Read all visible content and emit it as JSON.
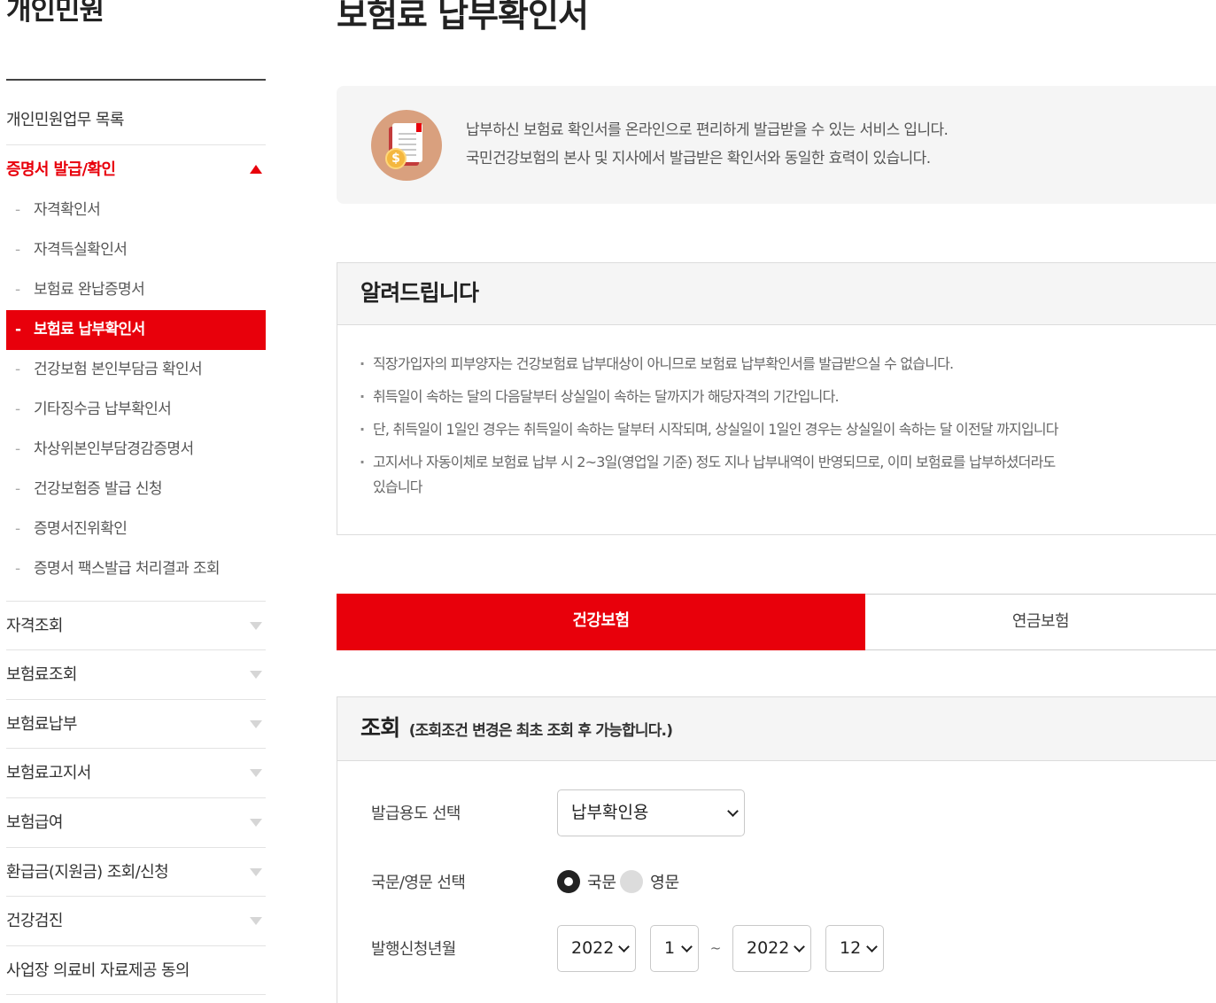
{
  "sidebar": {
    "title": "개인민원",
    "items": [
      {
        "label": "개인민원업무 목록"
      },
      {
        "label": "증명서 발급/확인",
        "open": true
      }
    ],
    "submenu": [
      {
        "label": "자격확인서"
      },
      {
        "label": "자격득실확인서"
      },
      {
        "label": "보험료 완납증명서"
      },
      {
        "label": "보험료 납부확인서",
        "active": true
      },
      {
        "label": "건강보험 본인부담금 확인서"
      },
      {
        "label": "기타징수금 납부확인서"
      },
      {
        "label": "차상위본인부담경감증명서"
      },
      {
        "label": "건강보험증 발급 신청"
      },
      {
        "label": "증명서진위확인"
      },
      {
        "label": "증명서 팩스발급 처리결과 조회"
      }
    ],
    "more_items": [
      {
        "label": "자격조회"
      },
      {
        "label": "보험료조회"
      },
      {
        "label": "보험료납부"
      },
      {
        "label": "보험료고지서"
      },
      {
        "label": "보험급여"
      },
      {
        "label": "환급금(지원금) 조회/신청"
      },
      {
        "label": "건강검진"
      },
      {
        "label": "사업장 의료비 자료제공 동의"
      }
    ],
    "dash": "-"
  },
  "page": {
    "title": "보험료 납부확인서"
  },
  "intro": {
    "line1": "납부하신 보험료 확인서를 온라인으로 편리하게 발급받을 수 있는 서비스 입니다.",
    "line2": "국민건강보험의 본사 및 지사에서 발급받은 확인서와 동일한 효력이 있습니다.",
    "coin_symbol": "$"
  },
  "notice": {
    "title": "알려드립니다",
    "items": [
      "직장가입자의 피부양자는 건강보험료 납부대상이 아니므로 보험료 납부확인서를 발급받으실 수 없습니다.",
      "취득일이 속하는 달의 다음달부터 상실일이 속하는 달까지가 해당자격의 기간입니다.",
      "단, 취득일이 1일인 경우는 취득일이 속하는 달부터 시작되며, 상실일이 1일인 경우는 상실일이 속하는 달 이전달 까지입니다",
      "고지서나 자동이체로 보험료 납부 시 2~3일(영업일 기준) 정도 지나 납부내역이 반영되므로, 이미 보험료를 납부하셨더라도",
      "있습니다"
    ]
  },
  "tabs": [
    {
      "label": "건강보험",
      "active": true
    },
    {
      "label": "연금보험",
      "active": false
    }
  ],
  "query": {
    "title": "조회",
    "subtitle": "(조회조건 변경은 최초 조회 후 가능합니다.)",
    "purpose_label": "발급용도 선택",
    "purpose_value": "납부확인용",
    "lang_label": "국문/영문 선택",
    "lang_options": [
      {
        "label": "국문",
        "selected": true
      },
      {
        "label": "영문",
        "selected": false
      }
    ],
    "period_label": "발행신청년월",
    "from_year": "2022",
    "from_month": "1",
    "tilde": "~",
    "to_year": "2022",
    "to_month": "12"
  },
  "colors": {
    "accent": "#e8000b",
    "panel": "#f5f5f5"
  }
}
